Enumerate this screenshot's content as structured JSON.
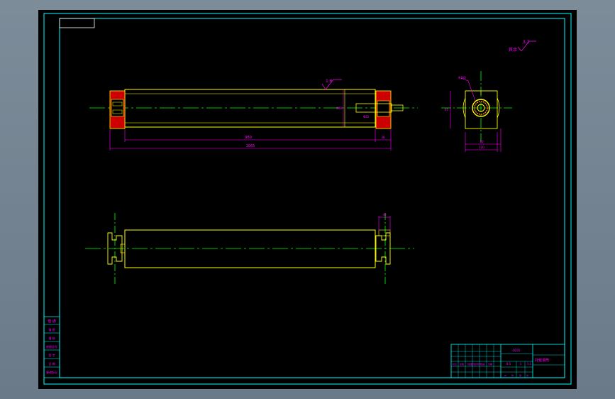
{
  "colors": {
    "viewport_bg": "#6f8090",
    "sheet_bg": "#000000",
    "frame": "#00ffff",
    "outline": "#ffff00",
    "centerline": "#00ff00",
    "dimension": "#ff00ff",
    "hatch": "#ff0000",
    "text": "#ff00ff"
  },
  "annotations": {
    "roughness_top": "1.6",
    "roughness_corner_value": "3.2",
    "roughness_corner_label": "其余",
    "dim_overall_inner": "980",
    "dim_overall_outer": "1065",
    "dim_end_right": "38",
    "dim_bore": "Φ48",
    "dim_shaft": "Φ25",
    "dim_section_dia": "Φ160",
    "dim_section_width": "120",
    "dim_section_bottom": "80",
    "dim_section_height": "65",
    "dim_plan_end": "40"
  },
  "revision_table": {
    "header": "借  通",
    "rows": [
      "描  图",
      "描  校",
      "底图总号",
      "签  字",
      "日  期",
      "更改标记"
    ]
  },
  "title_block": {
    "drawing_name": "托辊滚筒",
    "material": "Q235",
    "scale": "1:1",
    "weight": "8.5",
    "qty": "1",
    "sheet_labels": [
      "共",
      "张",
      "第",
      "张"
    ],
    "sign_labels": [
      "标记",
      "处数",
      "分区",
      "更改文件号",
      "签名",
      "日期"
    ]
  }
}
